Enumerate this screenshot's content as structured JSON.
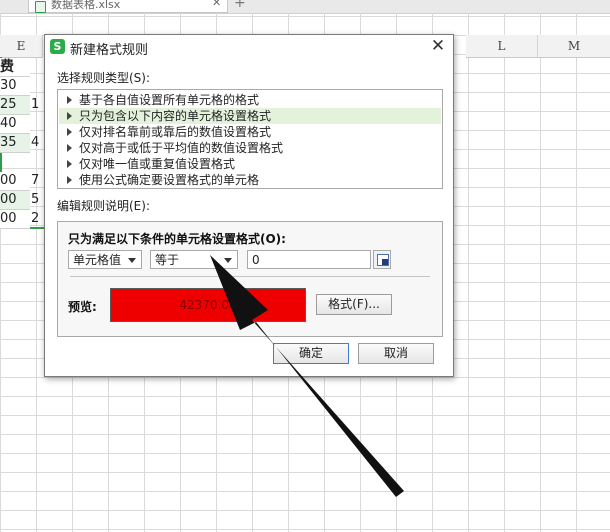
{
  "spreadsheet": {
    "file_tab_name": "数据表格.xlsx",
    "file_tab_close": "✕",
    "new_tab": "+",
    "col_headers": [
      "L",
      "M"
    ],
    "partial_col_header": "E",
    "cells": [
      "费",
      "30",
      "25",
      "40",
      "35",
      "00",
      "00",
      "00"
    ],
    "cells_col2": [
      "1",
      "4",
      "7",
      "5",
      "2"
    ]
  },
  "dialog": {
    "title": "新建格式规则",
    "icon_letter": "S",
    "close": "✕",
    "rule_type_label": "选择规则类型(S):",
    "rule_types": [
      "基于各自值设置所有单元格的格式",
      "只为包含以下内容的单元格设置格式",
      "仅对排名靠前或靠后的数值设置格式",
      "仅对高于或低于平均值的数值设置格式",
      "仅对唯一值或重复值设置格式",
      "使用公式确定要设置格式的单元格"
    ],
    "selected_rule_index": 1,
    "edit_desc_label": "编辑规则说明(E):",
    "edit_heading": "只为满足以下条件的单元格设置格式(O):",
    "condition_type": "单元格值",
    "operator": "等于",
    "value": "0",
    "preview_label": "预览:",
    "preview_sample": "42370.00",
    "preview_fill_color": "#ee0000",
    "format_button": "格式(F)...",
    "ok_button": "确定",
    "cancel_button": "取消"
  }
}
